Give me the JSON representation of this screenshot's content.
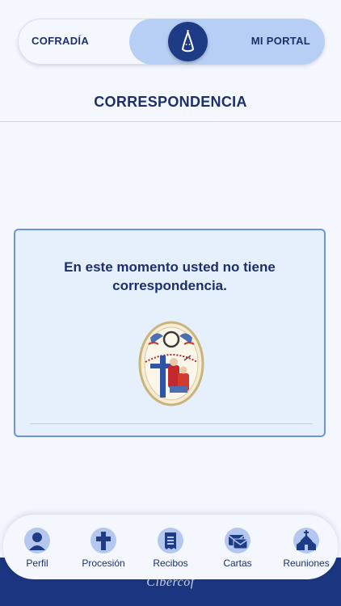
{
  "toggle": {
    "left_label": "COFRADÍA",
    "right_label": "MI PORTAL",
    "knob_icon": "hood-icon"
  },
  "page": {
    "title": "CORRESPONDENCIA"
  },
  "card": {
    "message": "En este momento usted no tiene correspondencia.",
    "emblem": "brotherhood-emblem"
  },
  "nav": {
    "items": [
      {
        "label": "Perfil",
        "icon": "person-icon"
      },
      {
        "label": "Procesión",
        "icon": "cross-icon"
      },
      {
        "label": "Recibos",
        "icon": "receipt-icon"
      },
      {
        "label": "Cartas",
        "icon": "letters-icon"
      },
      {
        "label": "Reuniones",
        "icon": "church-icon"
      }
    ]
  },
  "footer": {
    "brand": "Cibercof"
  },
  "colors": {
    "primary": "#1c2f6b",
    "accent": "#1e3b86",
    "toggle_active": "#b8cff5",
    "card_border": "#6a95da",
    "card_bg": "#e6effc"
  }
}
